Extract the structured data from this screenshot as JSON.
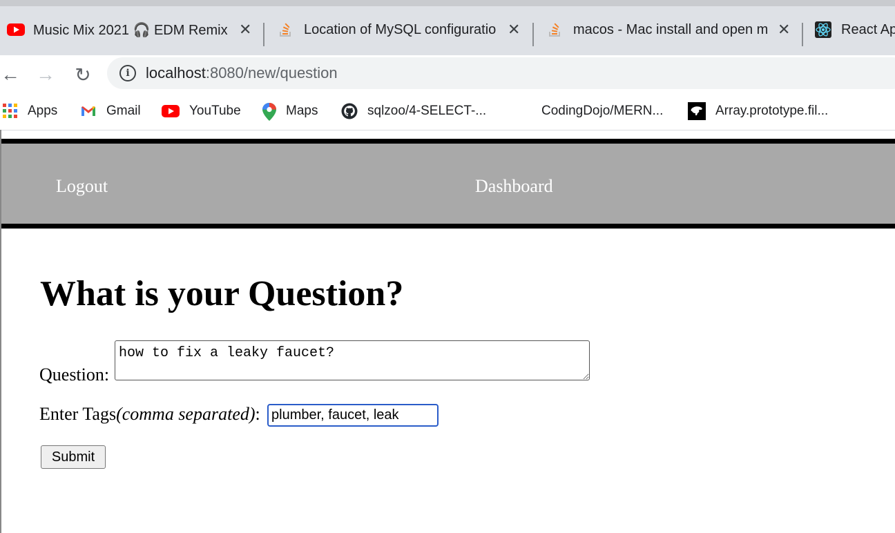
{
  "tabs": [
    {
      "title": "Music Mix 2021 🎧 EDM Remix",
      "icon": "youtube-icon"
    },
    {
      "title": "Location of MySQL configuratio",
      "icon": "stackoverflow-icon"
    },
    {
      "title": "macos - Mac install and open m",
      "icon": "stackoverflow-icon"
    },
    {
      "title": "React Ap",
      "icon": "react-icon"
    }
  ],
  "toolbar": {
    "back": "←",
    "forward": "→",
    "reload": "↻",
    "url_host": "localhost",
    "url_path": ":8080/new/question"
  },
  "bookmarks": [
    {
      "label": "Apps",
      "icon": "apps-grid-icon"
    },
    {
      "label": "Gmail",
      "icon": "gmail-icon"
    },
    {
      "label": "YouTube",
      "icon": "youtube-icon"
    },
    {
      "label": "Maps",
      "icon": "maps-pin-icon"
    },
    {
      "label": "sqlzoo/4-SELECT-...",
      "icon": "github-icon"
    },
    {
      "label": "CodingDojo/MERN...",
      "icon": "none"
    },
    {
      "label": "Array.prototype.fil...",
      "icon": "dinosaur-icon"
    }
  ],
  "nav": {
    "logout": "Logout",
    "dashboard": "Dashboard"
  },
  "form": {
    "heading": "What is your Question?",
    "question_label": "Question:",
    "question_value": "how to fix a leaky faucet?",
    "tags_label": "Enter Tags",
    "tags_hint": "(comma separated)",
    "tags_colon": ":",
    "tags_value": "plumber, faucet, leak",
    "submit_label": "Submit"
  },
  "colors": {
    "navbar_bg": "#a9a9a9",
    "focus_ring": "#2a5cc9",
    "youtube_red": "#ff0000"
  }
}
